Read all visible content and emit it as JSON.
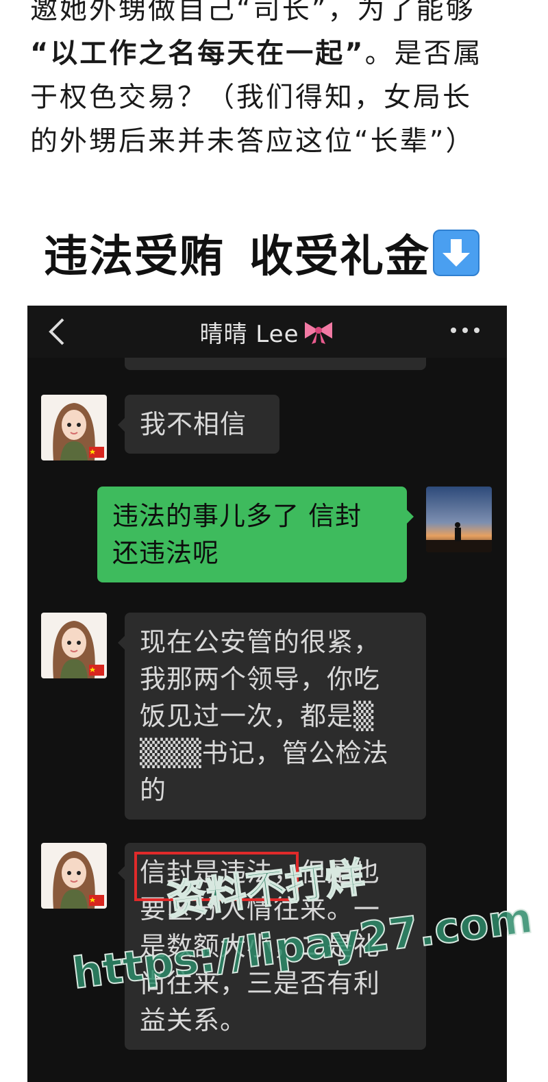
{
  "article": {
    "line1": "邀她外甥做自己“司长”，为了能够",
    "line2_bold": "“以工作之名每天在一起”",
    "line2_rest": "。是否属",
    "line3": "于权色交易？（我们得知，女局长",
    "line4": "的外甥后来并未答应这位“长辈”）"
  },
  "section_heading": {
    "part1": "违法受贿",
    "part2": "收受礼金",
    "icon": "down-arrow-icon"
  },
  "chat": {
    "title": "晴晴 Lee",
    "title_icon": "pink-bow-icon",
    "back_icon": "chevron-left-icon",
    "more_icon": "more-dots-icon",
    "messages": [
      {
        "side": "in",
        "lines": [
          "我不相信"
        ]
      },
      {
        "side": "out",
        "lines": [
          "违法的事儿多了 信封",
          "还违法呢"
        ]
      },
      {
        "side": "in",
        "lines": [
          "现在公安管的很紧，",
          "我那两个领导，你吃",
          "饭见过一次，都是▒",
          "▒▒▒书记，管公检法",
          "的"
        ]
      },
      {
        "side": "in",
        "lines": [
          "信封是违法，但是也",
          "要区分人情往来。一",
          "是数额大小，二是礼",
          "尚往来，三是否有利",
          "益关系。"
        ]
      }
    ]
  },
  "watermark": {
    "line1": "资料不打烊",
    "line2": "https://lipay27.com"
  },
  "colors": {
    "out_bubble": "#3ebb5d",
    "in_bubble": "#2c2c2c",
    "chat_bg": "#111111",
    "highlight": "#e02a2a",
    "watermark": "#2e8b6a"
  }
}
